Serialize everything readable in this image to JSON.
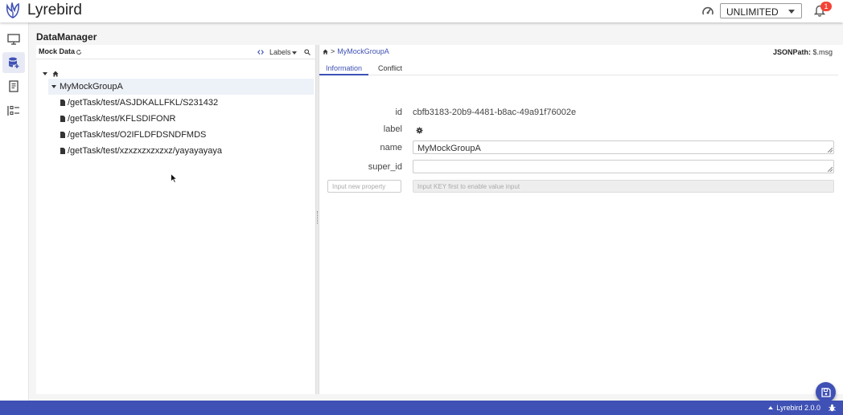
{
  "header": {
    "app_title": "Lyrebird",
    "mode_select": "UNLIMITED",
    "notification_count": "1"
  },
  "sidebar": {
    "items": [
      {
        "icon": "monitor-icon"
      },
      {
        "icon": "database-add-icon",
        "active": true
      },
      {
        "icon": "report-icon"
      },
      {
        "icon": "list-icon"
      }
    ]
  },
  "page": {
    "title": "DataManager"
  },
  "left_panel": {
    "title": "Mock Data",
    "labels_label": "Labels",
    "group": "MyMockGroupA",
    "files": [
      "/getTask/test/ASJDKALLFKL/S231432",
      "/getTask/test/KFLSDIFONR",
      "/getTask/test/O2IFLDFDSNDFMDS",
      "/getTask/test/xzxzxzxzxzxz/yayayayaya"
    ]
  },
  "right_panel": {
    "breadcrumb_sep": ">",
    "breadcrumb": "MyMockGroupA",
    "jsonpath_label": "JSONPath:",
    "jsonpath_value": "$.msg",
    "tabs": [
      "Information",
      "Conflict"
    ],
    "fields": {
      "id_label": "id",
      "id_value": "cbfb3183-20b9-4481-b8ac-49a91f76002e",
      "label_label": "label",
      "name_label": "name",
      "name_value": "MyMockGroupA",
      "super_id_label": "super_id",
      "super_id_value": ""
    },
    "new_property_placeholder": "Input new property",
    "value_placeholder": "Input KEY first to enable value input"
  },
  "footer": {
    "version": "Lyrebird 2.0.0"
  },
  "colors": {
    "primary": "#3f51b5",
    "badge": "#f44336"
  }
}
